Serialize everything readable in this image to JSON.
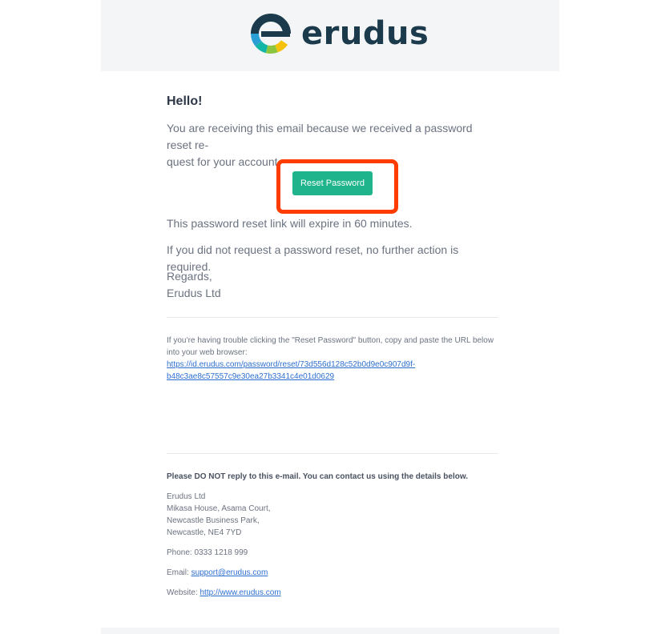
{
  "brand": {
    "name": "erudus",
    "logo_colors": [
      "#1b3a4b",
      "#12b5a6",
      "#8cc63f",
      "#f4c20d",
      "#2a9fd6"
    ]
  },
  "email": {
    "greeting": "Hello!",
    "intro": "You are receiving this email because we received a password reset request for your account.",
    "intro_line1": "You are receiving this email because we received a password reset re-",
    "intro_line2": "quest for your account.",
    "button_label": "Reset Password",
    "expiry": "This password reset link will expire in 60 minutes.",
    "no_action": "If you did not request a password reset, no further action is required.",
    "regards": "Regards,",
    "signature": "Erudus Ltd",
    "trouble_line1": "If you’re having trouble clicking the \"Reset Password\" button, copy and paste the URL below",
    "trouble_line2": "into your web browser:",
    "reset_url_line1": "https://id.erudus.com/password/reset/73d556d128c52b0d9e0c907d9f-",
    "reset_url_line2": "b48c3ae8c57557c9e30ea27b3341c4e01d0629"
  },
  "footer": {
    "notice": "Please DO NOT reply to this e-mail. You can contact us using the details below.",
    "address": [
      "Erudus Ltd",
      "Mikasa House, Asama Court,",
      "Newcastle Business Park,",
      "Newcastle, NE4 7YD"
    ],
    "phone_label": "Phone: ",
    "phone": "0333 1218 999",
    "email_label": "Email: ",
    "email": "support@erudus.com",
    "website_label": "Website: ",
    "website": "http://www.erudus.com"
  },
  "colors": {
    "button": "#1fb48b",
    "highlight": "#ff3c00",
    "link": "#2d6fd0",
    "header_bg": "#f4f5f7"
  }
}
